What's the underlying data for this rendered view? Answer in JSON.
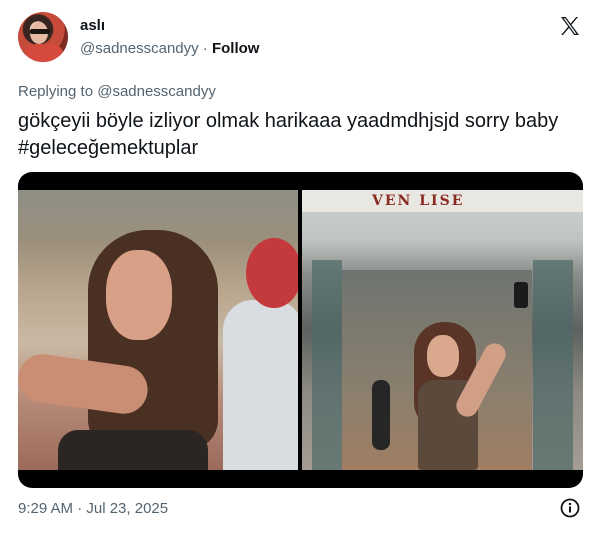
{
  "author": {
    "name": "aslı",
    "handle": "@sadnesscandyy",
    "separator": "·",
    "follow_label": "Follow",
    "avatar_icon": "profile-avatar"
  },
  "platform_icon": "x-logo",
  "reply": {
    "replying_to": "Replying to @sadnesscandyy"
  },
  "tweet": {
    "text": "gökçeyii böyle izliyor olmak harikaaa yaadmdhjsjd sorry baby #geleceğemektuplar"
  },
  "media": {
    "images": [
      {
        "alt": "photo-left-selfie"
      },
      {
        "alt": "photo-right-selfie",
        "sign_text": "VEN LISE"
      }
    ]
  },
  "footer": {
    "timestamp": "9:29 AM · Jul 23, 2025",
    "info_icon": "info-icon"
  },
  "colors": {
    "text_primary": "#0f1419",
    "text_secondary": "#536471",
    "background": "#ffffff"
  }
}
